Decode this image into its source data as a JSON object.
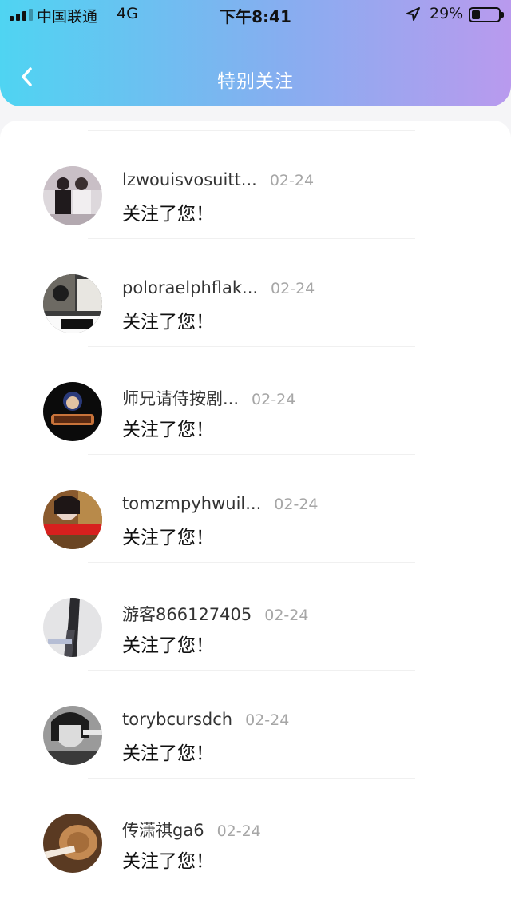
{
  "status_bar": {
    "carrier": "中国联通",
    "network": "4G",
    "time": "下午8:41",
    "battery_percent": "29%",
    "battery_level": 0.29,
    "icons": [
      "signal-icon",
      "location-arrow-icon",
      "battery-icon"
    ]
  },
  "header": {
    "title": "特别关注",
    "back_icon": "chevron-left-icon",
    "gradient_colors": [
      "#4fd4f2",
      "#86aef0",
      "#b99aee"
    ]
  },
  "list": {
    "items": [
      {
        "username": "lzwouisvosuitt...",
        "date": "02-24",
        "message": "关注了您！"
      },
      {
        "username": "poloraelphflak...",
        "date": "02-24",
        "message": "关注了您！"
      },
      {
        "username": "师兄请侍按剧...",
        "date": "02-24",
        "message": "关注了您！"
      },
      {
        "username": "tomzmpyhwuil...",
        "date": "02-24",
        "message": "关注了您！"
      },
      {
        "username": "游客866127405",
        "date": "02-24",
        "message": "关注了您！"
      },
      {
        "username": "torybcursdch",
        "date": "02-24",
        "message": "关注了您！"
      },
      {
        "username": "传潇祺ga6",
        "date": "02-24",
        "message": "关注了您！"
      }
    ]
  },
  "colors": {
    "username": "#333333",
    "date": "#a6a6a6",
    "message": "#111111",
    "page_bg": "#f5f5f7"
  }
}
